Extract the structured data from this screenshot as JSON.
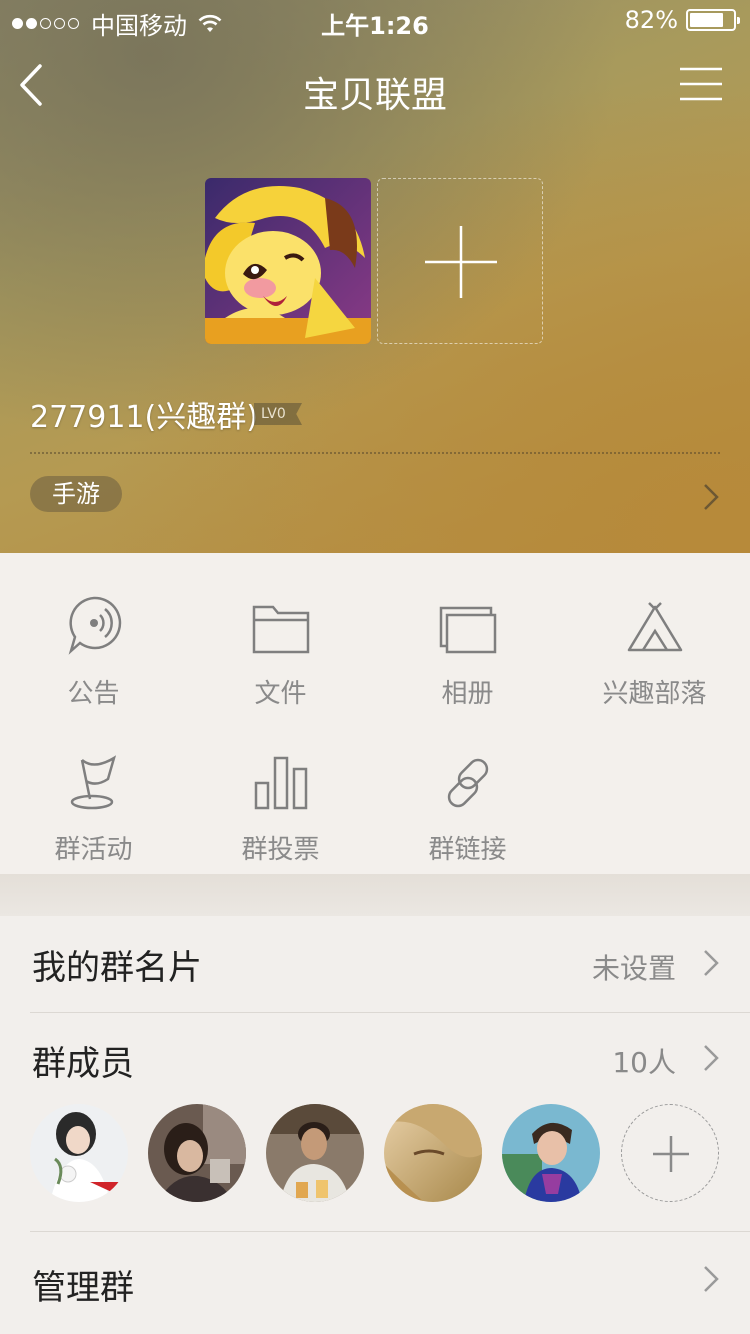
{
  "status_bar": {
    "carrier": "中国移动",
    "time": "上午1:26",
    "battery": "82%",
    "battery_level": 0.82,
    "signal_bars": 2,
    "signal_total": 5
  },
  "nav": {
    "title": "宝贝联盟",
    "back_icon": "chevron-left-icon",
    "menu_icon": "hamburger-menu-icon"
  },
  "group": {
    "id_text": "277911(兴趣群)",
    "level": "LV0",
    "tag": "手游"
  },
  "features": [
    {
      "label": "公告",
      "icon": "announcement-icon"
    },
    {
      "label": "文件",
      "icon": "folder-icon"
    },
    {
      "label": "相册",
      "icon": "album-icon"
    },
    {
      "label": "兴趣部落",
      "icon": "tent-icon"
    },
    {
      "label": "群活动",
      "icon": "flag-icon"
    },
    {
      "label": "群投票",
      "icon": "bar-chart-icon"
    },
    {
      "label": "群链接",
      "icon": "link-icon"
    }
  ],
  "list": {
    "card": {
      "title": "我的群名片",
      "value": "未设置"
    },
    "members": {
      "title": "群成员",
      "value": "10人"
    },
    "manage": {
      "title": "管理群"
    }
  },
  "colors": {
    "header_gold": "#b59a52",
    "grid_label": "#8a8a8a",
    "icon_stroke": "#7f7f7f"
  }
}
